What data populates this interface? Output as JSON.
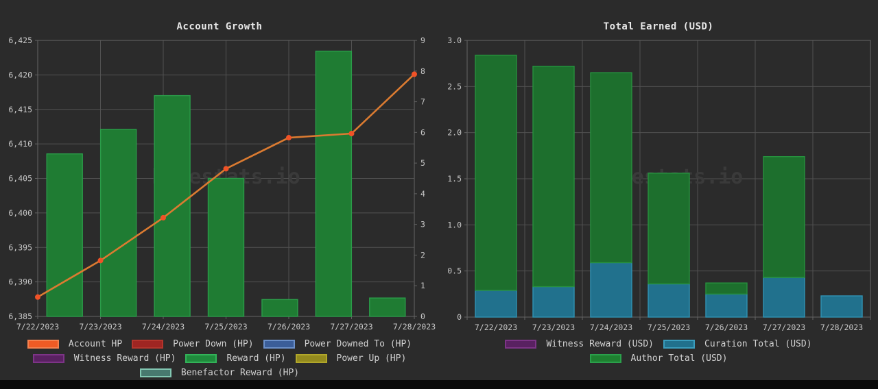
{
  "page": {
    "background": "#2b2b2b",
    "bottom_bar_color": "#0a0a0a",
    "watermark": "hivestats.io"
  },
  "chart_data": [
    {
      "type": "bar",
      "title": "Account Growth",
      "categories": [
        "7/22/2023",
        "7/23/2023",
        "7/24/2023",
        "7/25/2023",
        "7/26/2023",
        "7/27/2023",
        "7/28/2023"
      ],
      "grid": true,
      "legend_position": "bottom",
      "axes": {
        "left": {
          "min": 6385,
          "max": 6425,
          "ticks": [
            "6,425",
            "6,420",
            "6,415",
            "6,410",
            "6,405",
            "6,400",
            "6,395",
            "6,390",
            "6,385"
          ]
        },
        "right": {
          "min": 0,
          "max": 9,
          "ticks": [
            "9",
            "8",
            "7",
            "6",
            "5",
            "4",
            "3",
            "2",
            "1",
            "0"
          ]
        }
      },
      "series": [
        {
          "name": "Reward (HP)",
          "type": "bar",
          "axis": "right",
          "values": [
            5.3,
            6.1,
            7.2,
            4.5,
            0.55,
            8.65,
            0.6
          ],
          "fill": "#1f7c33",
          "border": "#2b9c49"
        },
        {
          "name": "Power Down (HP)",
          "type": "bar",
          "axis": "right",
          "values": [
            0,
            0,
            0,
            0,
            0,
            0,
            0
          ],
          "fill": "#9f2522",
          "border": "#b3352c"
        },
        {
          "name": "Power Downed To (HP)",
          "type": "bar",
          "axis": "right",
          "values": [
            0,
            0,
            0,
            0,
            0,
            0,
            0
          ],
          "fill": "#3b5e99",
          "border": "#6b90c9"
        },
        {
          "name": "Witness Reward (HP)",
          "type": "bar",
          "axis": "right",
          "values": [
            0,
            0,
            0,
            0,
            0,
            0,
            0
          ],
          "fill": "#592161",
          "border": "#7d3487"
        },
        {
          "name": "Power Up (HP)",
          "type": "bar",
          "axis": "right",
          "values": [
            0,
            0,
            0,
            0,
            0,
            0,
            0
          ],
          "fill": "#938a1e",
          "border": "#b1a72a"
        },
        {
          "name": "Benefactor Reward (HP)",
          "type": "bar",
          "axis": "right",
          "values": [
            0,
            0,
            0,
            0,
            0,
            0,
            0
          ],
          "fill": "#48796f",
          "border": "#82c7b2"
        },
        {
          "name": "Account HP",
          "type": "line",
          "axis": "left",
          "values": [
            6387.8,
            6393.1,
            6399.3,
            6406.4,
            6410.9,
            6411.5,
            6420.1
          ],
          "color": "#db7b31",
          "point_color": "#f05227"
        }
      ],
      "legend_rows": [
        [
          {
            "label": "Account HP",
            "fill": "#ef5b25",
            "border": "#f4824f"
          },
          {
            "label": "Power Down (HP)",
            "fill": "#9f2522",
            "border": "#b3352c"
          },
          {
            "label": "Power Downed To (HP)",
            "fill": "#3b5e99",
            "border": "#6b90c9"
          }
        ],
        [
          {
            "label": "Witness Reward (HP)",
            "fill": "#592161",
            "border": "#7d3487"
          },
          {
            "label": "Reward (HP)",
            "fill": "#1f8a3c",
            "border": "#33b359"
          },
          {
            "label": "Power Up (HP)",
            "fill": "#938a1e",
            "border": "#b1a72a"
          }
        ],
        [
          {
            "label": "Benefactor Reward (HP)",
            "fill": "#48796f",
            "border": "#82c7b2"
          }
        ]
      ]
    },
    {
      "type": "bar",
      "title": "Total Earned (USD)",
      "categories": [
        "7/22/2023",
        "7/23/2023",
        "7/24/2023",
        "7/25/2023",
        "7/26/2023",
        "7/27/2023",
        "7/28/2023"
      ],
      "grid": true,
      "legend_position": "bottom",
      "stacked": true,
      "axes": {
        "left": {
          "min": 0,
          "max": 3,
          "ticks": [
            "3.0",
            "2.5",
            "2.0",
            "1.5",
            "1.0",
            "0.5",
            "0"
          ]
        }
      },
      "series": [
        {
          "name": "Witness Reward (USD)",
          "type": "bar",
          "axis": "left",
          "values": [
            0,
            0,
            0,
            0,
            0,
            0,
            0
          ],
          "fill": "#592161",
          "border": "#7d3487"
        },
        {
          "name": "Curation Total (USD)",
          "type": "bar",
          "axis": "left",
          "values": [
            0.29,
            0.33,
            0.59,
            0.36,
            0.25,
            0.43,
            0.23
          ],
          "fill": "#21718d",
          "border": "#3093b4"
        },
        {
          "name": "Author Total (USD)",
          "type": "bar",
          "axis": "left",
          "values": [
            2.55,
            2.39,
            2.06,
            1.2,
            0.12,
            1.31,
            0
          ],
          "fill": "#1d6f2d",
          "border": "#27913e"
        }
      ],
      "legend_rows": [
        [
          {
            "label": "Witness Reward (USD)",
            "fill": "#592161",
            "border": "#7d3487"
          },
          {
            "label": "Curation Total (USD)",
            "fill": "#21718d",
            "border": "#3a9dbd"
          }
        ],
        [
          {
            "label": "Author Total (USD)",
            "fill": "#1e8030",
            "border": "#2ba04b"
          }
        ]
      ]
    }
  ]
}
